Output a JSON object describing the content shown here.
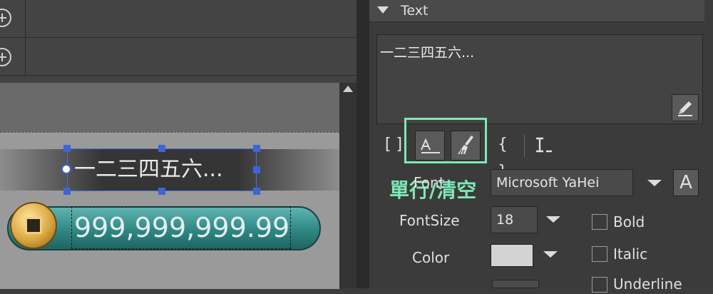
{
  "panel": {
    "section_title": "Text",
    "text_value": "一二三四五六...",
    "toolbar": {
      "brackets_label": "[ ]",
      "braces_label": "{ }",
      "caption": "單行/清空"
    },
    "font": {
      "label": "Font",
      "value": "Microsoft YaHei",
      "button_label": "A"
    },
    "font_size": {
      "label": "FontSize",
      "value": "18"
    },
    "color": {
      "label": "Color",
      "value": "#d3d3d3"
    },
    "checkboxes": [
      {
        "label": "Bold",
        "checked": false
      },
      {
        "label": "Italic",
        "checked": false
      },
      {
        "label": "Underline",
        "checked": false
      }
    ]
  },
  "canvas": {
    "label_text": "一二三四五六...",
    "money_text": "999,999,999.99"
  },
  "colors": {
    "highlight": "#7de8b7",
    "selection": "#3f64d4"
  },
  "icons": [
    "expand-icon",
    "collapse-arrow-icon",
    "pencil-icon",
    "single-line-icon",
    "brush-icon",
    "text-cursor-icon",
    "scroll-up-icon",
    "dropdown-arrow-icon",
    "coin-icon"
  ]
}
